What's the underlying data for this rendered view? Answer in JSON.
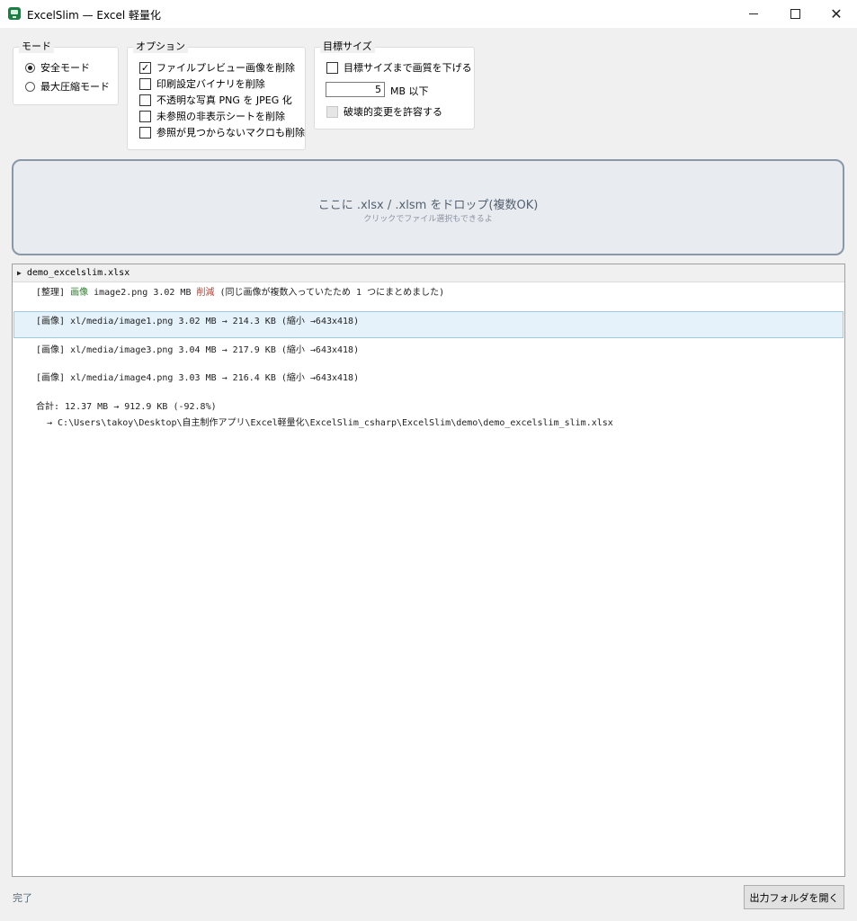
{
  "window": {
    "title": "ExcelSlim — Excel 軽量化",
    "minimize": "—",
    "maximize": "☐",
    "close": "✕"
  },
  "mode": {
    "legend": "モード",
    "options": [
      {
        "label": "安全モード",
        "selected": true
      },
      {
        "label": "最大圧縮モード",
        "selected": false
      }
    ]
  },
  "options": {
    "legend": "オプション",
    "items": [
      {
        "label": "ファイルプレビュー画像を削除",
        "checked": true
      },
      {
        "label": "印刷設定バイナリを削除",
        "checked": false
      },
      {
        "label": "不透明な写真 PNG を JPEG 化",
        "checked": false
      },
      {
        "label": "未参照の非表示シートを削除",
        "checked": false
      },
      {
        "label": "参照が見つからないマクロも削除",
        "checked": false
      }
    ]
  },
  "target": {
    "legend": "目標サイズ",
    "reduce_label": "目標サイズまで画質を下げる",
    "size_value": "5",
    "size_unit": "MB 以下",
    "destructive_label": "破壊的変更を許容する"
  },
  "dropzone": {
    "main": "ここに .xlsx / .xlsm をドロップ(複数OK)",
    "sub": "クリックでファイル選択もできるよ"
  },
  "log": {
    "file_name": "demo_excelslim.xlsx",
    "cleanup": {
      "tag": "[整理]",
      "kw": "画像",
      "rest1": " image2.png  3.02 MB ",
      "action": "削減",
      "rest2": " (同じ画像が複数入っていたため 1 つにまとめました)"
    },
    "images": [
      {
        "tag": "[画像]",
        "text": " xl/media/image1.png  3.02 MB → 214.3 KB  (縮小 →643x418)"
      },
      {
        "tag": "[画像]",
        "text": " xl/media/image3.png  3.04 MB → 217.9 KB  (縮小 →643x418)"
      },
      {
        "tag": "[画像]",
        "text": " xl/media/image4.png  3.03 MB → 216.4 KB  (縮小 →643x418)"
      }
    ],
    "total": "合計: 12.37 MB → 912.9 KB  (-92.8%)",
    "output_path": "→ C:\\Users\\takoy\\Desktop\\自主制作アプリ\\Excel軽量化\\ExcelSlim_csharp\\ExcelSlim\\demo\\demo_excelslim_slim.xlsx"
  },
  "status": {
    "text": "完了",
    "open_folder": "出力フォルダを開く"
  }
}
